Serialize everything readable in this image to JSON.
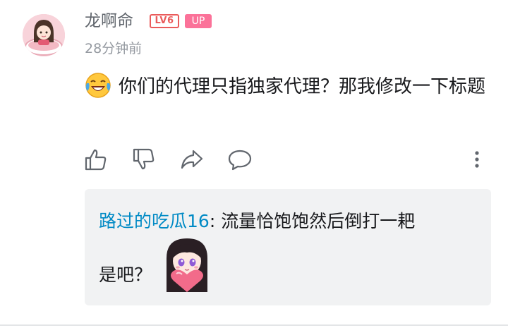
{
  "comment": {
    "username": "龙啊命",
    "level_badge": "LV6",
    "up_badge": "UP",
    "timestamp": "28分钟前",
    "emoji_icon": "laugh-cry-emoji-icon",
    "text": "你们的代理只指独家代理？那我修改一下标题"
  },
  "actions": {
    "like_icon": "thumbs-up-icon",
    "dislike_icon": "thumbs-down-icon",
    "share_icon": "share-icon",
    "reply_icon": "comment-bubble-icon",
    "more_icon": "more-vertical-icon"
  },
  "reply": {
    "username": "路过的吃瓜16",
    "separator": ":",
    "text_line1": " 流量恰饱饱然后倒打一耙",
    "text_line2": "是吧？",
    "sticker_icon": "anime-girl-heart-sticker-icon"
  },
  "colors": {
    "accent_pink": "#fb7299",
    "level_red": "#ea5b5b",
    "reply_link": "#008ac5",
    "muted": "#9499a0"
  }
}
